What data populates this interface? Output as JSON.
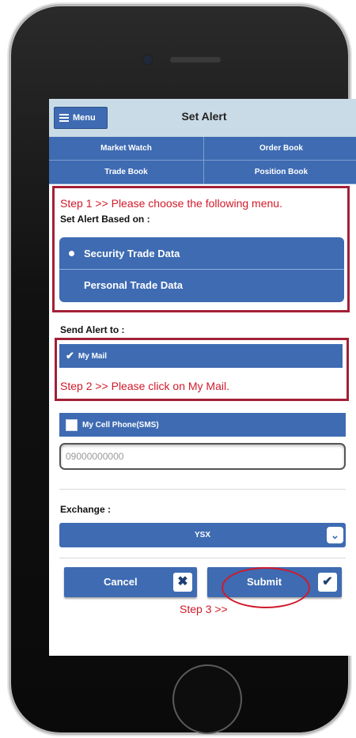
{
  "header": {
    "menu_label": "Menu",
    "title": "Set Alert"
  },
  "tabs": [
    "Market Watch",
    "Order Book",
    "Trade Book",
    "Position Book"
  ],
  "step1": {
    "note": "Step 1 >> Please choose the following menu.",
    "label": "Set Alert Based on :",
    "options": [
      {
        "label": "Security Trade Data",
        "selected": true
      },
      {
        "label": "Personal Trade Data",
        "selected": false
      }
    ]
  },
  "send_alert": {
    "label": "Send Alert to :",
    "my_mail": "My Mail",
    "step2_note": "Step 2 >> Please click on My Mail.",
    "cell_phone": "My Cell Phone(SMS)",
    "phone_value": "09000000000"
  },
  "exchange": {
    "label": "Exchange :",
    "value": "YSX"
  },
  "actions": {
    "cancel": "Cancel",
    "submit": "Submit",
    "step3_note": "Step 3 >>"
  },
  "colors": {
    "primary": "#3e6bb2",
    "annotation": "#d11a2a",
    "header_bg": "#c9dbe6"
  }
}
